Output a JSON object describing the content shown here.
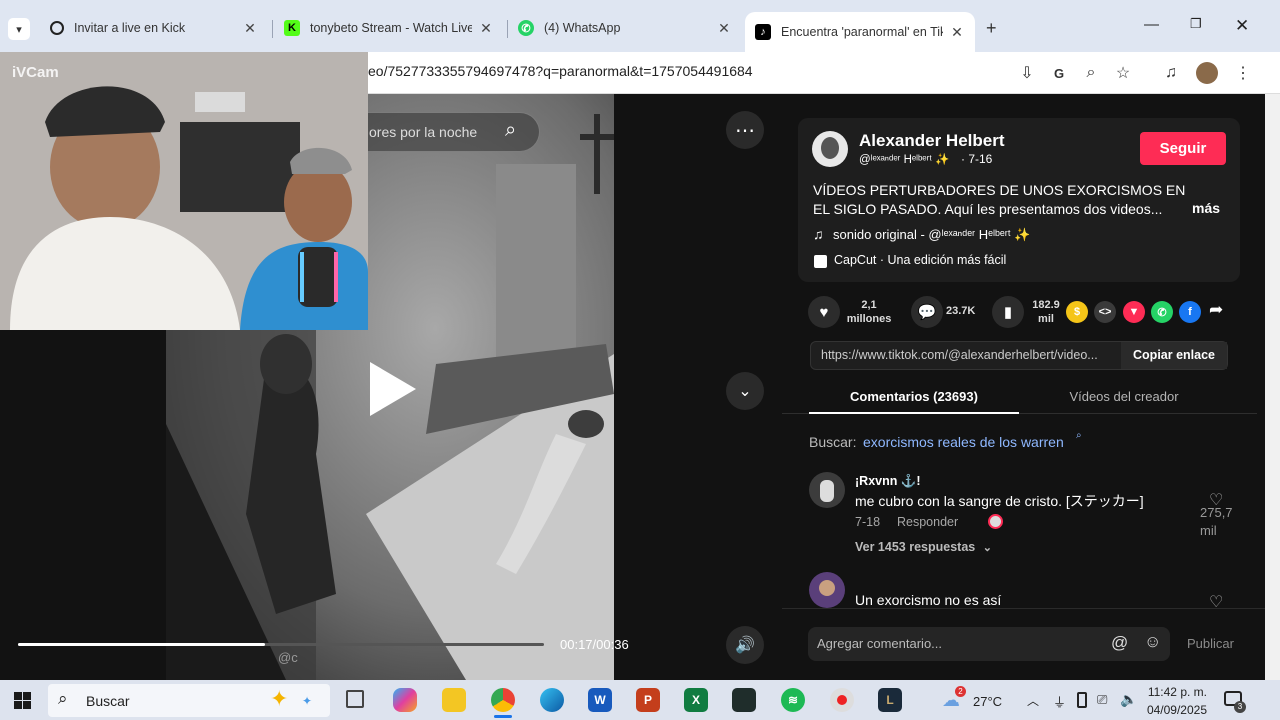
{
  "browser": {
    "tabs": [
      {
        "title": "Invitar a live en Kick",
        "icon": "openai-icon"
      },
      {
        "title": "tonybeto Stream - Watch Live o",
        "icon": "kick-icon"
      },
      {
        "title": "(4) WhatsApp",
        "icon": "whatsapp-icon"
      },
      {
        "title": "Encuentra 'paranormal' en TikTo",
        "icon": "tiktok-icon"
      }
    ],
    "url": "eo/7527733355794697478?q=paranormal&t=1757054491684"
  },
  "webcam": {
    "label": "iVCam"
  },
  "video": {
    "search_placeholder": "ores por la noche",
    "time": "00:17/00:36",
    "progress": 0.47,
    "watermark": "@c"
  },
  "author": {
    "name": "Alexander Helbert",
    "handle": "@ˡᵉˣᵃⁿᵈᵉʳ Hᵉˡᵇᵉʳᵗ ✨",
    "date": "· 7-16",
    "follow_label": "Seguir",
    "description": "VÍDEOS PERTURBADORES DE UNOS EXORCISMOS EN EL SIGLO PASADO. Aquí les presentamos dos videos...",
    "more_label": "más",
    "sound": "sonido original - @ˡᵉˣᵃⁿᵈᵉʳ Hᵉˡᵇᵉʳᵗ ✨",
    "capcut": "CapCut · Una edición más fácil"
  },
  "stats": {
    "likes_line1": "2,1",
    "likes_line2": "millones",
    "comments": "23.7K",
    "saves_line1": "182.9",
    "saves_line2": "mil"
  },
  "link": {
    "url": "https://www.tiktok.com/@alexanderhelbert/video...",
    "copy_label": "Copiar enlace"
  },
  "tabs": {
    "comments": "Comentarios (23693)",
    "creator": "Vídeos del creador"
  },
  "search_suggest": {
    "label": "Buscar:",
    "query": "exorcismos reales de los warren"
  },
  "comments": [
    {
      "user": "¡Rxvnn ⚓!",
      "text": "me cubro con la sangre de cristo. [ステッカー]",
      "date": "7-18",
      "reply_label": "Responder",
      "likes_line1": "275,7",
      "likes_line2": "mil",
      "replies_label": "Ver 1453 respuestas"
    },
    {
      "user": "",
      "text": "Un exorcismo no es así"
    }
  ],
  "comment_input": {
    "placeholder": "Agregar comentario...",
    "publish_label": "Publicar"
  },
  "taskbar": {
    "search_label": "Buscar",
    "weather": "27°C",
    "weather_badge": "2",
    "time": "11:42 p. m.",
    "date": "04/09/2025",
    "notif_badge": "3"
  },
  "colors": {
    "follow": "#fe2c55",
    "link": "#8fb8ff",
    "tiktok_bg": "#121212"
  }
}
